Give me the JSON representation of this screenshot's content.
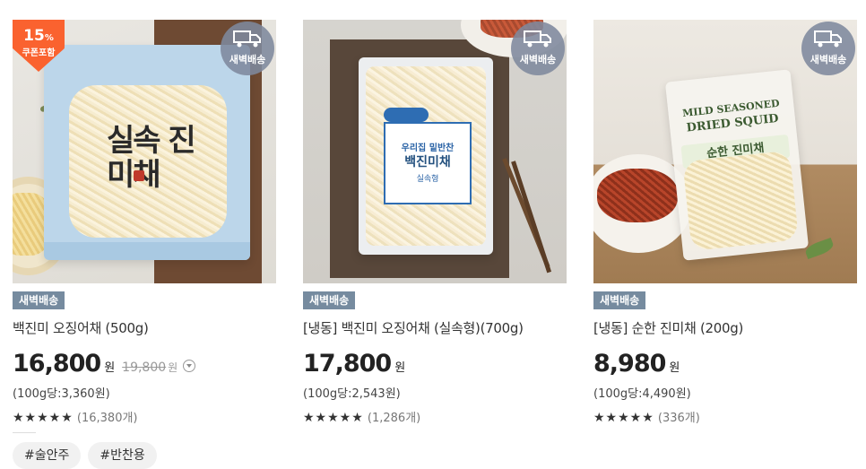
{
  "products": [
    {
      "badge_discount": "15",
      "badge_discount_unit": "%",
      "badge_coupon": "쿠폰포함",
      "dawn_delivery_overlay": "새벽배송",
      "delivery_tag": "새벽배송",
      "name": "백진미 오징어채 (500g)",
      "price": "16,800",
      "price_unit": "원",
      "original_price": "19,800",
      "original_price_unit": "원",
      "unit_price": "(100g당:3,360원)",
      "stars": "★★★★★",
      "review_count": "(16,380개)",
      "hashtags": [
        "#술안주",
        "#반찬용"
      ],
      "image_text": "실속 진미채"
    },
    {
      "dawn_delivery_overlay": "새벽배송",
      "delivery_tag": "새벽배송",
      "name": "[냉동] 백진미 오징어채 (실속형)(700g)",
      "price": "17,800",
      "price_unit": "원",
      "unit_price": "(100g당:2,543원)",
      "stars": "★★★★★",
      "review_count": "(1,286개)",
      "image_text": {
        "line1": "우리집 밑반찬",
        "line2": "백진미채",
        "line3": "실속형"
      }
    },
    {
      "dawn_delivery_overlay": "새벽배송",
      "delivery_tag": "새벽배송",
      "name": "[냉동] 순한 진미채 (200g)",
      "price": "8,980",
      "price_unit": "원",
      "unit_price": "(100g당:4,490원)",
      "stars": "★★★★★",
      "review_count": "(336개)",
      "image_text": {
        "line1": "MILD SEASONED",
        "line2": "DRIED SQUID",
        "line3": "순한 진미채"
      }
    }
  ],
  "colors": {
    "delivery_badge": "#768b9f",
    "discount_badge": "#fa622f",
    "dawn_overlay": "#7e899d"
  },
  "icons": {
    "truck": "truck-icon",
    "info": "info-chevron-icon",
    "star": "star-icon"
  }
}
